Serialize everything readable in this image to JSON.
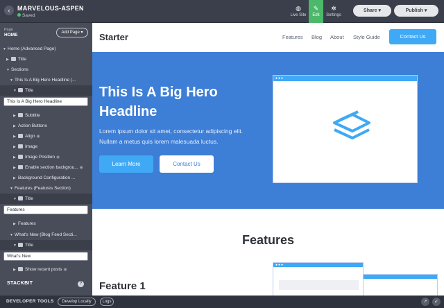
{
  "app": {
    "site_name": "MARVELOUS-ASPEN",
    "status": "Saved",
    "tools": [
      {
        "label": "Live Site",
        "icon": "globe-icon"
      },
      {
        "label": "Edit",
        "icon": "pencil-icon"
      },
      {
        "label": "Settings",
        "icon": "gear-icon"
      }
    ],
    "share_label": "Share",
    "publish_label": "Publish"
  },
  "sidebar": {
    "page_label": "Page",
    "page_value": "HOME",
    "add_page_label": "Add Page",
    "tree": [
      "Home (Advanced Page)",
      "Title",
      "Sections",
      "This Is A Big Hero Headline (...",
      "Title",
      "Subtitle",
      "Action Buttons",
      "Align",
      "Image",
      "Image Position",
      "Enable section backgrou...",
      "Background Configuration ...",
      "Features (Features Section)",
      "Title",
      "Features",
      "What's New (Blog Feed Secti...",
      "Title",
      "Show recent posts"
    ],
    "fields": {
      "hero_title": "This Is A Big Hero Headline",
      "features_title": "Features",
      "whats_new_title": "What's New"
    },
    "brand": "STACKBIT"
  },
  "bottombar": {
    "label": "DEVELOPER TOOLS",
    "develop_locally": "Develop Locally",
    "logs": "Logs"
  },
  "preview": {
    "logo": "Starter",
    "nav": [
      "Features",
      "Blog",
      "About",
      "Style Guide"
    ],
    "contact_label": "Contact Us",
    "hero": {
      "headline": "This Is A Big Hero Headline",
      "paragraph": "Lorem ipsum dolor sit amet, consectetur adipiscing elit. Nullam a metus quis lorem malesuada luctus.",
      "learn_more": "Learn More",
      "contact": "Contact Us"
    },
    "features_heading": "Features",
    "feature1_heading": "Feature 1"
  },
  "colors": {
    "edit_active": "#4cb86a",
    "hero_bg": "#3d7ed6",
    "accent": "#3fa9f5",
    "sidebar_bg": "#494d59"
  }
}
